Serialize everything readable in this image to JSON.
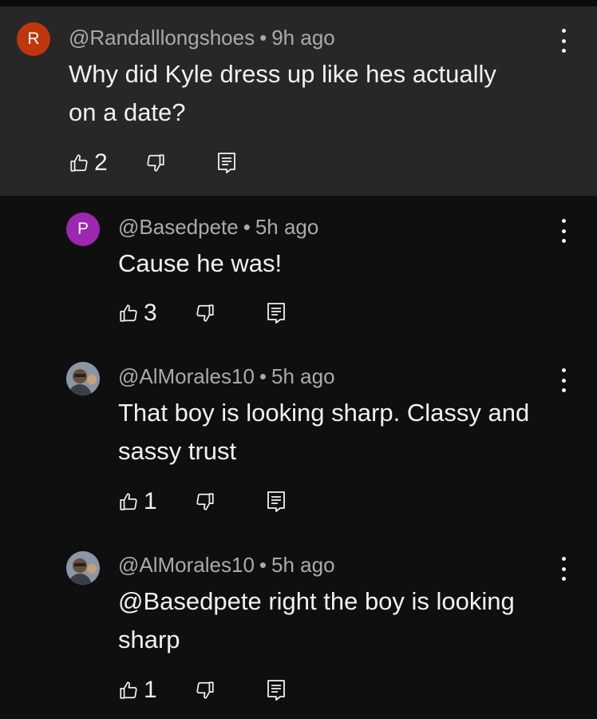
{
  "comments": [
    {
      "avatar_letter": "R",
      "avatar_color": "#bf360c",
      "handle": "@Randalllongshoes",
      "time": "9h ago",
      "text": "Why did Kyle dress up like hes actually on a date?",
      "likes": "2"
    },
    {
      "avatar_letter": "P",
      "avatar_color": "#9c27b0",
      "handle": "@Basedpete",
      "time": "5h ago",
      "text": "Cause he was!",
      "likes": "3"
    },
    {
      "avatar_letter": "",
      "avatar_color": "#6e7a86",
      "handle": "@AlMorales10",
      "time": "5h ago",
      "text": "That boy is looking sharp. Classy and sassy trust",
      "likes": "1"
    },
    {
      "avatar_letter": "",
      "avatar_color": "#6e7a86",
      "handle": "@AlMorales10",
      "time": "5h ago",
      "text": "@Basedpete right the boy is looking sharp",
      "likes": "1"
    }
  ],
  "meta_separator": "•",
  "colors": {
    "background": "#0f0f0f",
    "highlight": "#272727",
    "secondary_text": "#aaaaaa"
  }
}
